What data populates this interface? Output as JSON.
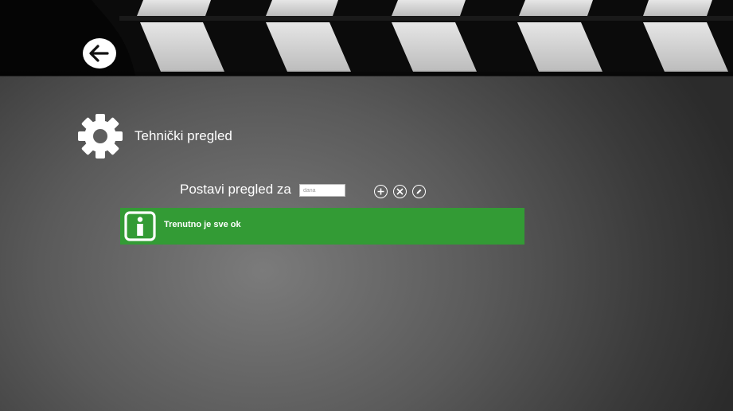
{
  "header": {
    "back_icon": "arrow-left-icon"
  },
  "section": {
    "icon": "gear-icon",
    "title": "Tehnički pregled"
  },
  "schedule": {
    "label": "Postavi pregled za",
    "days_placeholder": "dana",
    "days_value": "",
    "actions": [
      {
        "name": "add",
        "icon": "plus-icon"
      },
      {
        "name": "remove",
        "icon": "close-icon"
      },
      {
        "name": "edit",
        "icon": "pencil-icon"
      }
    ]
  },
  "status": {
    "icon": "info-icon",
    "message": "Trenutno je sve ok",
    "color": "#339b35"
  },
  "colors": {
    "accent_green": "#339b35",
    "clapper_dark": "#0a0a0a",
    "clapper_stripe": "#d7d7d7"
  }
}
